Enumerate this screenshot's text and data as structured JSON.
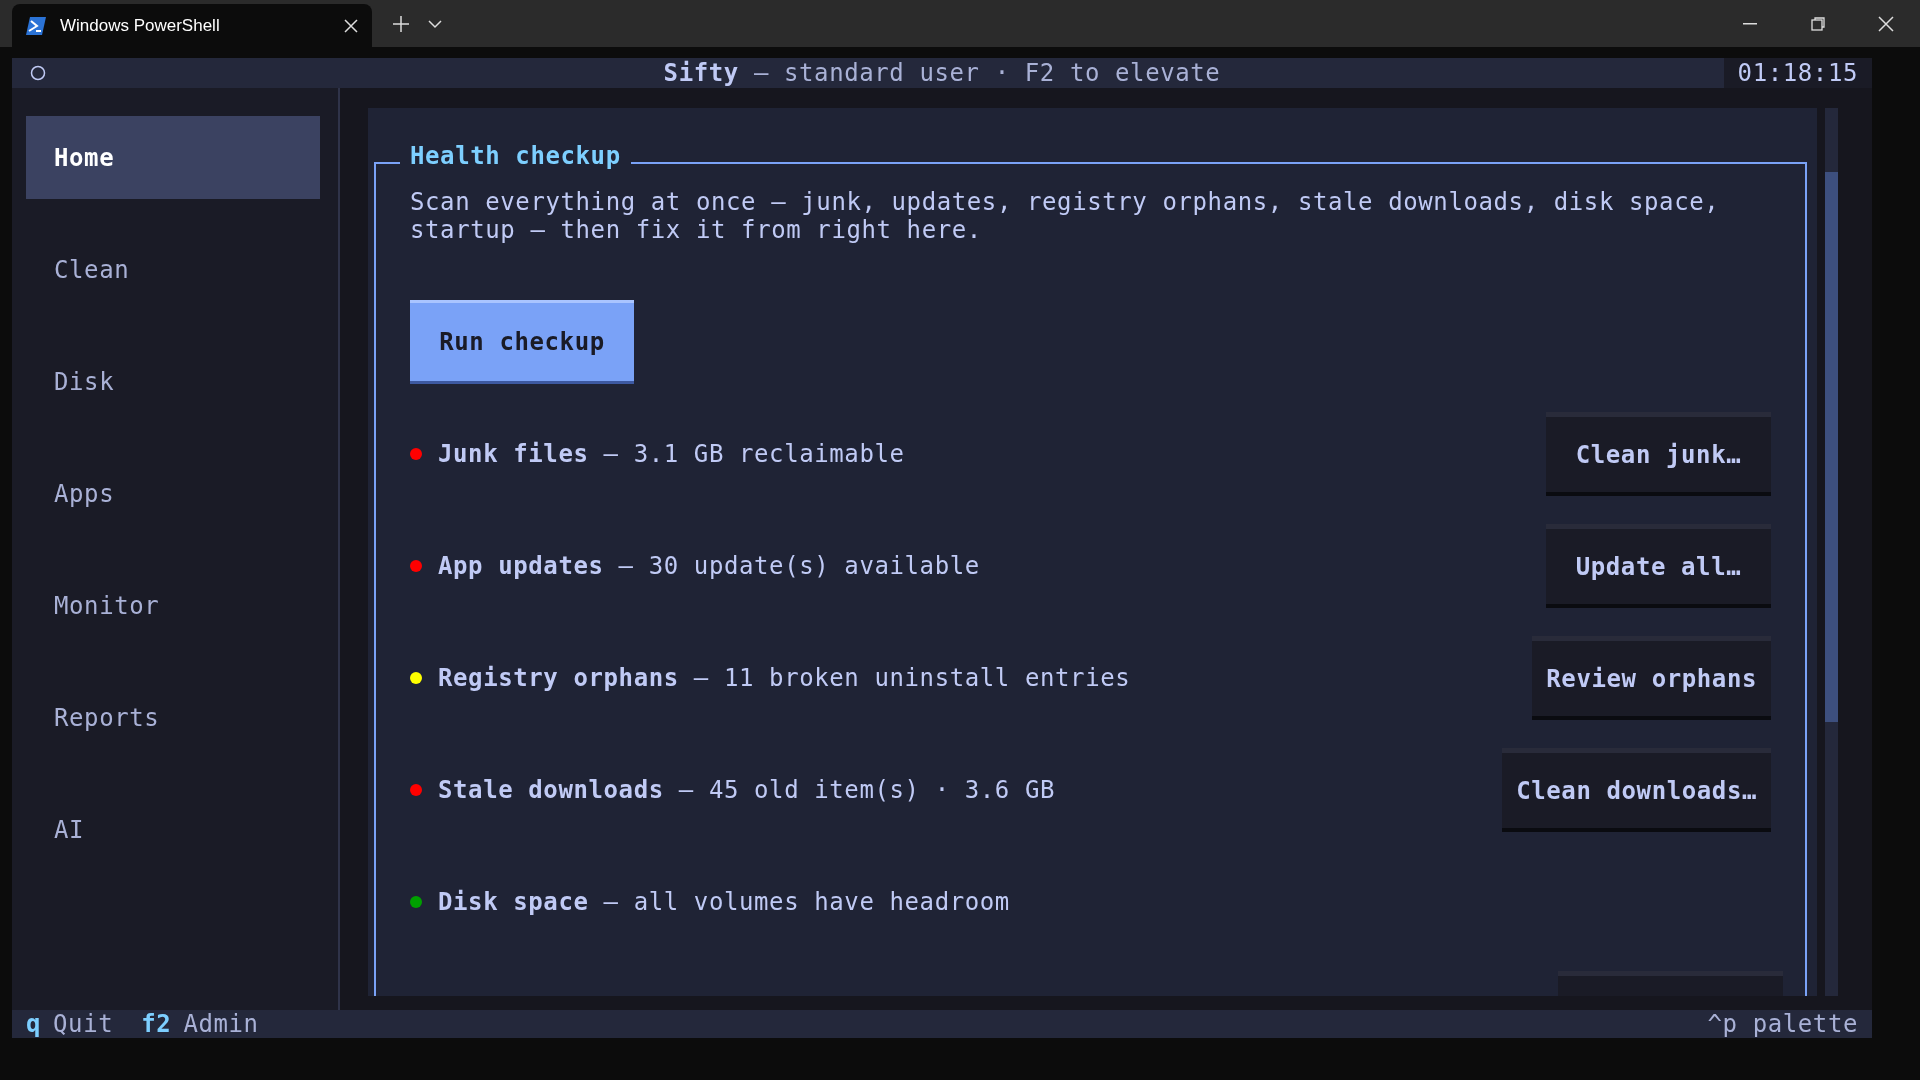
{
  "window": {
    "tab_title": "Windows PowerShell"
  },
  "header": {
    "app": "Sifty",
    "subtitle": "— standard user · F2 to elevate",
    "clock": "01:18:15"
  },
  "sidebar": {
    "items": [
      {
        "label": "Home",
        "selected": true
      },
      {
        "label": "Clean",
        "selected": false
      },
      {
        "label": "Disk",
        "selected": false
      },
      {
        "label": "Apps",
        "selected": false
      },
      {
        "label": "Monitor",
        "selected": false
      },
      {
        "label": "Reports",
        "selected": false
      },
      {
        "label": "AI",
        "selected": false
      }
    ]
  },
  "panel": {
    "title": "Health checkup",
    "description": "Scan everything at once — junk, updates, registry orphans, stale downloads, disk space, startup — then fix it from right here.",
    "run_button": "Run checkup",
    "checks": [
      {
        "name": "Junk files",
        "detail": "— 3.1 GB reclaimable",
        "color": "#ff0000",
        "action": "Clean junk…"
      },
      {
        "name": "App updates",
        "detail": "— 30 update(s) available",
        "color": "#ff0000",
        "action": "Update all…"
      },
      {
        "name": "Registry orphans",
        "detail": "— 11 broken uninstall entries",
        "color": "#ffff00",
        "action": "Review orphans"
      },
      {
        "name": "Stale downloads",
        "detail": "— 45 old item(s) · 3.6 GB",
        "color": "#ff0000",
        "action": "Clean downloads…"
      },
      {
        "name": "Disk space",
        "detail": "— all volumes have headroom",
        "color": "#00a000"
      }
    ]
  },
  "footer": {
    "keys": [
      {
        "key": "q",
        "label": "Quit"
      },
      {
        "key": "f2",
        "label": "Admin"
      }
    ],
    "palette": "^p palette"
  }
}
